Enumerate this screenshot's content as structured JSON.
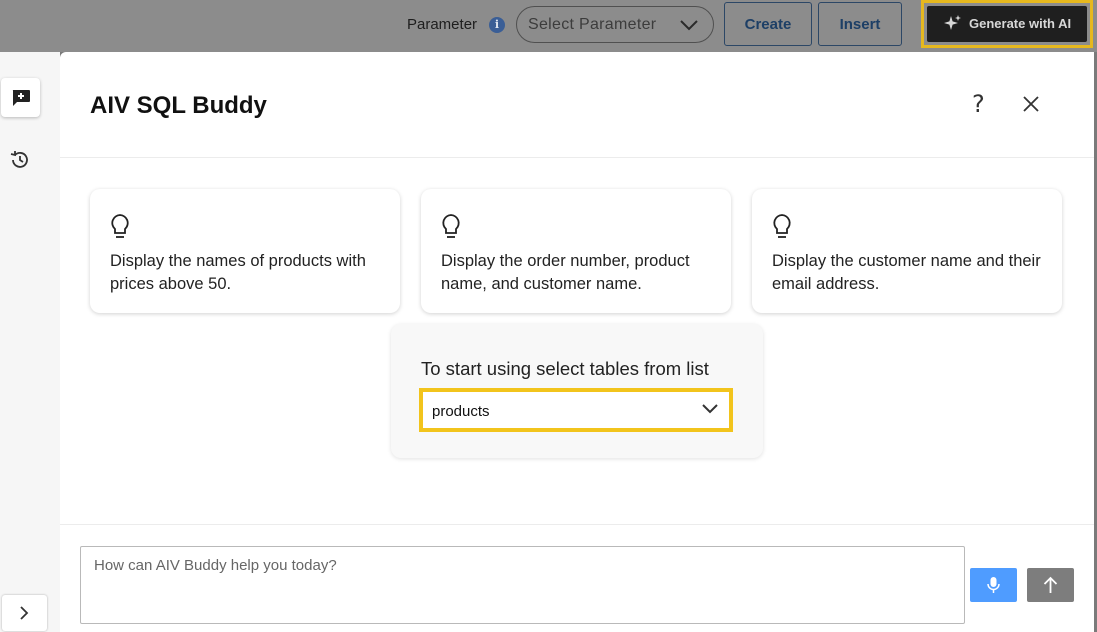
{
  "toolbar": {
    "parameter_label": "Parameter",
    "parameter_placeholder": "Select Parameter",
    "create_label": "Create",
    "insert_label": "Insert",
    "generate_label": "Generate with AI"
  },
  "panel": {
    "title": "AIV SQL Buddy",
    "help_glyph": "?"
  },
  "suggestions": [
    {
      "text": "Display the names of products with prices above 50."
    },
    {
      "text": "Display the order number, product name, and customer name."
    },
    {
      "text": "Display the customer name and their email address."
    }
  ],
  "table_picker": {
    "prompt": "To start using select tables from list",
    "selected": "products"
  },
  "chat": {
    "placeholder": "How can AIV Buddy help you today?"
  },
  "icons": {
    "info": "info-icon",
    "dropdown": "chevron-down-icon",
    "sparkle": "sparkle-icon",
    "new_chat": "chat-plus-icon",
    "history": "history-icon",
    "expand": "chevron-right-icon",
    "help": "help-icon",
    "close": "close-icon",
    "suggestion": "lightbulb-icon",
    "mic": "microphone-icon",
    "send": "arrow-up-icon"
  },
  "colors": {
    "highlight": "#f2c41c",
    "accent_blue": "#4f9cff",
    "generate_bg": "#1f1f1f",
    "overlay": "#8c8c8c"
  }
}
